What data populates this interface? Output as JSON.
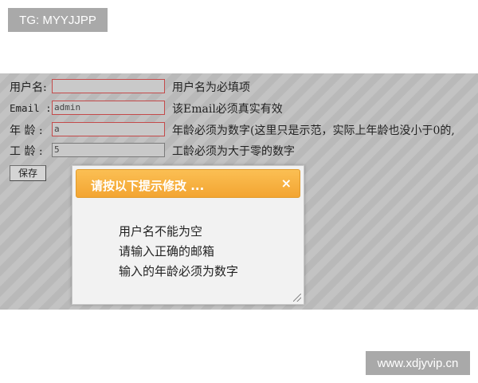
{
  "watermark_top": "TG: MYYJJPP",
  "form": {
    "rows": [
      {
        "label": "用户名:",
        "value": "",
        "hint": "用户名为必填项"
      },
      {
        "label": "Email :",
        "value": "admin",
        "hint": "该Email必须真实有效"
      },
      {
        "label": "年 龄 :",
        "value": "a",
        "hint": "年龄必须为数字(这里只是示范，实际上年龄也没小于0的,"
      },
      {
        "label": "工 龄 :",
        "value": "5",
        "hint": "工龄必须为大于零的数字"
      }
    ],
    "save_label": "保存"
  },
  "dialog": {
    "title": "请按以下提示修改 ...",
    "close": "×",
    "messages": [
      "用户名不能为空",
      "请输入正确的邮箱",
      "输入的年龄必须为数字"
    ]
  },
  "watermark_bottom": "www.xdjyvip.cn",
  "colors": {
    "form_bg": "#b9b9b9",
    "dialog_header": "#f8b446",
    "error_border": "#c44a4a"
  }
}
